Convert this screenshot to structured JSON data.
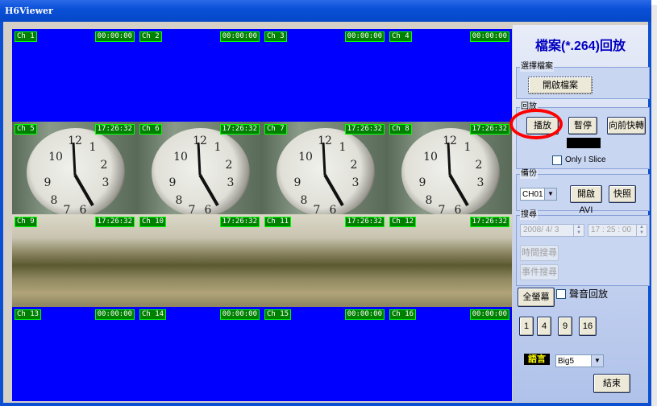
{
  "window": {
    "title": "H6Viewer"
  },
  "channels": [
    {
      "ch": "Ch 1",
      "time": "00:00:00",
      "view": "blue"
    },
    {
      "ch": "Ch 2",
      "time": "00:00:00",
      "view": "blue"
    },
    {
      "ch": "Ch 3",
      "time": "00:00:00",
      "view": "blue"
    },
    {
      "ch": "Ch 4",
      "time": "00:00:00",
      "view": "blue"
    },
    {
      "ch": "Ch 5",
      "time": "17:26:32",
      "view": "clock"
    },
    {
      "ch": "Ch 6",
      "time": "17:26:32",
      "view": "clock"
    },
    {
      "ch": "Ch 7",
      "time": "17:26:32",
      "view": "clock"
    },
    {
      "ch": "Ch 8",
      "time": "17:26:32",
      "view": "clock"
    },
    {
      "ch": "Ch 9",
      "time": "17:26:32",
      "view": "room"
    },
    {
      "ch": "Ch 10",
      "time": "17:26:32",
      "view": "room"
    },
    {
      "ch": "Ch 11",
      "time": "17:26:32",
      "view": "room"
    },
    {
      "ch": "Ch 12",
      "time": "17:26:32",
      "view": "room"
    },
    {
      "ch": "Ch 13",
      "time": "00:00:00",
      "view": "blue"
    },
    {
      "ch": "Ch 14",
      "time": "00:00:00",
      "view": "blue"
    },
    {
      "ch": "Ch 15",
      "time": "00:00:00",
      "view": "blue"
    },
    {
      "ch": "Ch 16",
      "time": "00:00:00",
      "view": "blue"
    }
  ],
  "panel": {
    "title": "檔案(*.264)回放",
    "file_group": {
      "label": "選擇檔案",
      "open_button": "開啟檔案"
    },
    "playback_group": {
      "label": "回放",
      "play_button": "播放",
      "pause_button": "暫停",
      "forward_button": "向前快轉",
      "only_i_slice": "Only I Slice",
      "only_i_slice_checked": false
    },
    "backup_group": {
      "label": "備份",
      "channel_select": "CH01",
      "open_avi_button": "開啟AVI",
      "snapshot_button": "快照"
    },
    "search_group": {
      "label": "搜尋",
      "date": "2008/ 4/ 3",
      "time": "17 : 25 : 00",
      "time_search_button": "時間搜尋",
      "event_search_button": "事件搜尋"
    },
    "fullscreen_button": "全螢幕",
    "audio_playback_label": "聲音回放",
    "audio_playback_checked": false,
    "layout_buttons": [
      "1",
      "4",
      "9",
      "16"
    ],
    "language_label": "語言",
    "language_select": "Big5",
    "exit_button": "結束"
  },
  "colors": {
    "video_bg": "#0000ff",
    "label_bg": "#008000",
    "label_border": "#00ff00",
    "highlight_circle": "#ff0000"
  }
}
